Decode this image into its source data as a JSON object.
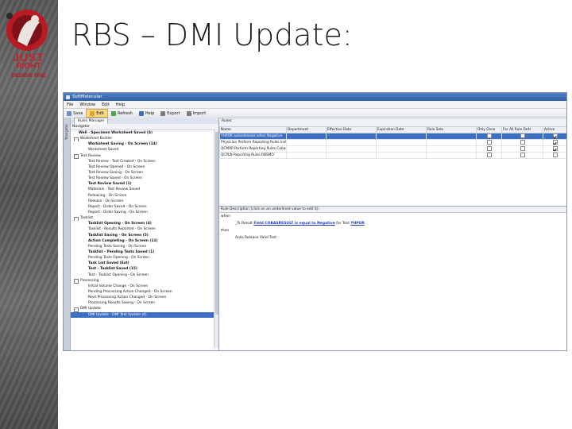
{
  "slide": {
    "title": "RBS – DMI Update:"
  },
  "logo": {
    "line1": "JUST",
    "line2": "RIGHT",
    "line3": "DESIGN ONE"
  },
  "app": {
    "window_title": "SoftMolecular",
    "menu": [
      "File",
      "Window",
      "Edit",
      "Help"
    ],
    "toolbar": [
      {
        "label": "Save",
        "color": "#6d8fc7"
      },
      {
        "label": "Edit",
        "color": "#e0a52b",
        "active": true
      },
      {
        "label": "Refresh",
        "color": "#4ea34a"
      },
      {
        "label": "Help",
        "color": "#3b6fc0"
      },
      {
        "label": "Export",
        "color": "#7a7a7a"
      },
      {
        "label": "Import",
        "color": "#7a7a7a"
      }
    ],
    "left_rail_label": "Navigator",
    "nav": {
      "tab": "Rules Manager",
      "header": "Navigator",
      "rows": [
        {
          "text": "Well - Specimen Worksheet Saved (4)",
          "indent": 1,
          "bold": true
        },
        {
          "text": "Worksheet Builder",
          "indent": 0,
          "exp": "-"
        },
        {
          "text": "Worksheet Saving - On Screen (14)",
          "indent": 2,
          "bold": true
        },
        {
          "text": "Worksheet Saved",
          "indent": 2
        },
        {
          "text": "Test Review",
          "indent": 0,
          "exp": "-"
        },
        {
          "text": "Test Review - Test Created - On Screen",
          "indent": 2
        },
        {
          "text": "Test Review Opened - On Screen",
          "indent": 2
        },
        {
          "text": "Test Review Saving - On Screen",
          "indent": 2
        },
        {
          "text": "Test Review Saved - On Screen",
          "indent": 2
        },
        {
          "text": "Test Review Saved (1)",
          "indent": 2,
          "bold": true
        },
        {
          "text": "Materials - Test Review Saved",
          "indent": 2
        },
        {
          "text": "Releasing - On Screen",
          "indent": 2
        },
        {
          "text": "Release - On Screen",
          "indent": 2
        },
        {
          "text": "Report - Order Saved - On Screen",
          "indent": 2
        },
        {
          "text": "Report - Order Saving - On Screen",
          "indent": 2
        },
        {
          "text": "Tasklist",
          "indent": 0,
          "exp": "-"
        },
        {
          "text": "Tasklist Opening - On Screen (4)",
          "indent": 2,
          "bold": true
        },
        {
          "text": "Tasklist - Results Reported - On Screen",
          "indent": 2
        },
        {
          "text": "Tasklist Saving - On Screen (5)",
          "indent": 2,
          "bold": true
        },
        {
          "text": "Action Completing - On Screen (11)",
          "indent": 2,
          "bold": true
        },
        {
          "text": "Pending Tests Saving - On Screen",
          "indent": 2
        },
        {
          "text": "Tasklist - Pending Tests Saved (1)",
          "indent": 2,
          "bold": true
        },
        {
          "text": "Pending Tests Opening - On Screen",
          "indent": 2
        },
        {
          "text": "Task List Saved (Ext)",
          "indent": 2,
          "bold": true
        },
        {
          "text": "Test - Tasklist Saved (15)",
          "indent": 2,
          "bold": true
        },
        {
          "text": "Test - Tasklist Opening - On Screen",
          "indent": 2
        },
        {
          "text": "Processing",
          "indent": 0,
          "exp": "-"
        },
        {
          "text": "Initial Volume Change - On Screen",
          "indent": 2
        },
        {
          "text": "Pending Processing Action Changed - On Screen",
          "indent": 2
        },
        {
          "text": "Next Processing Action Changed - On Screen",
          "indent": 2
        },
        {
          "text": "Processing Results Saving - On Screen",
          "indent": 2
        },
        {
          "text": "DMI Update",
          "indent": 0,
          "exp": "-"
        },
        {
          "text": "DMI Update - DMI Test Update (4)",
          "indent": 2,
          "selected": true
        }
      ]
    },
    "rules": {
      "label": "Rules:",
      "columns": [
        "Name",
        "Department",
        "Effective Date",
        "Expiration Date",
        "Rule Sets",
        "Only Once",
        "For All Rule Defs",
        "Active"
      ],
      "rows": [
        {
          "name": "YHPOR autoreleases when Negative",
          "only_once": false,
          "for_all": false,
          "active": true,
          "selected": true
        },
        {
          "name": "Physician Perform Reporting Rules Instrumen...",
          "only_once": false,
          "for_all": false,
          "active": true
        },
        {
          "name": "QCMAP Perform Reporting Rules Cobas & Pyro...",
          "only_once": false,
          "for_all": false,
          "active": true
        },
        {
          "name": "QCPLN Reporting Rules RBSMO",
          "only_once": false,
          "for_all": false,
          "active": false
        }
      ]
    },
    "description": {
      "header": "Rule Description (click on an underlined value to edit it):",
      "when_label": "when",
      "when_pre": "_Ts Result",
      "when_link": "Field COBASRESULT is equal to Negative",
      "when_mid": "for Test",
      "when_test": "YHPOR",
      "then_label": "then",
      "then_text": "Auto Release Valid Test"
    }
  }
}
